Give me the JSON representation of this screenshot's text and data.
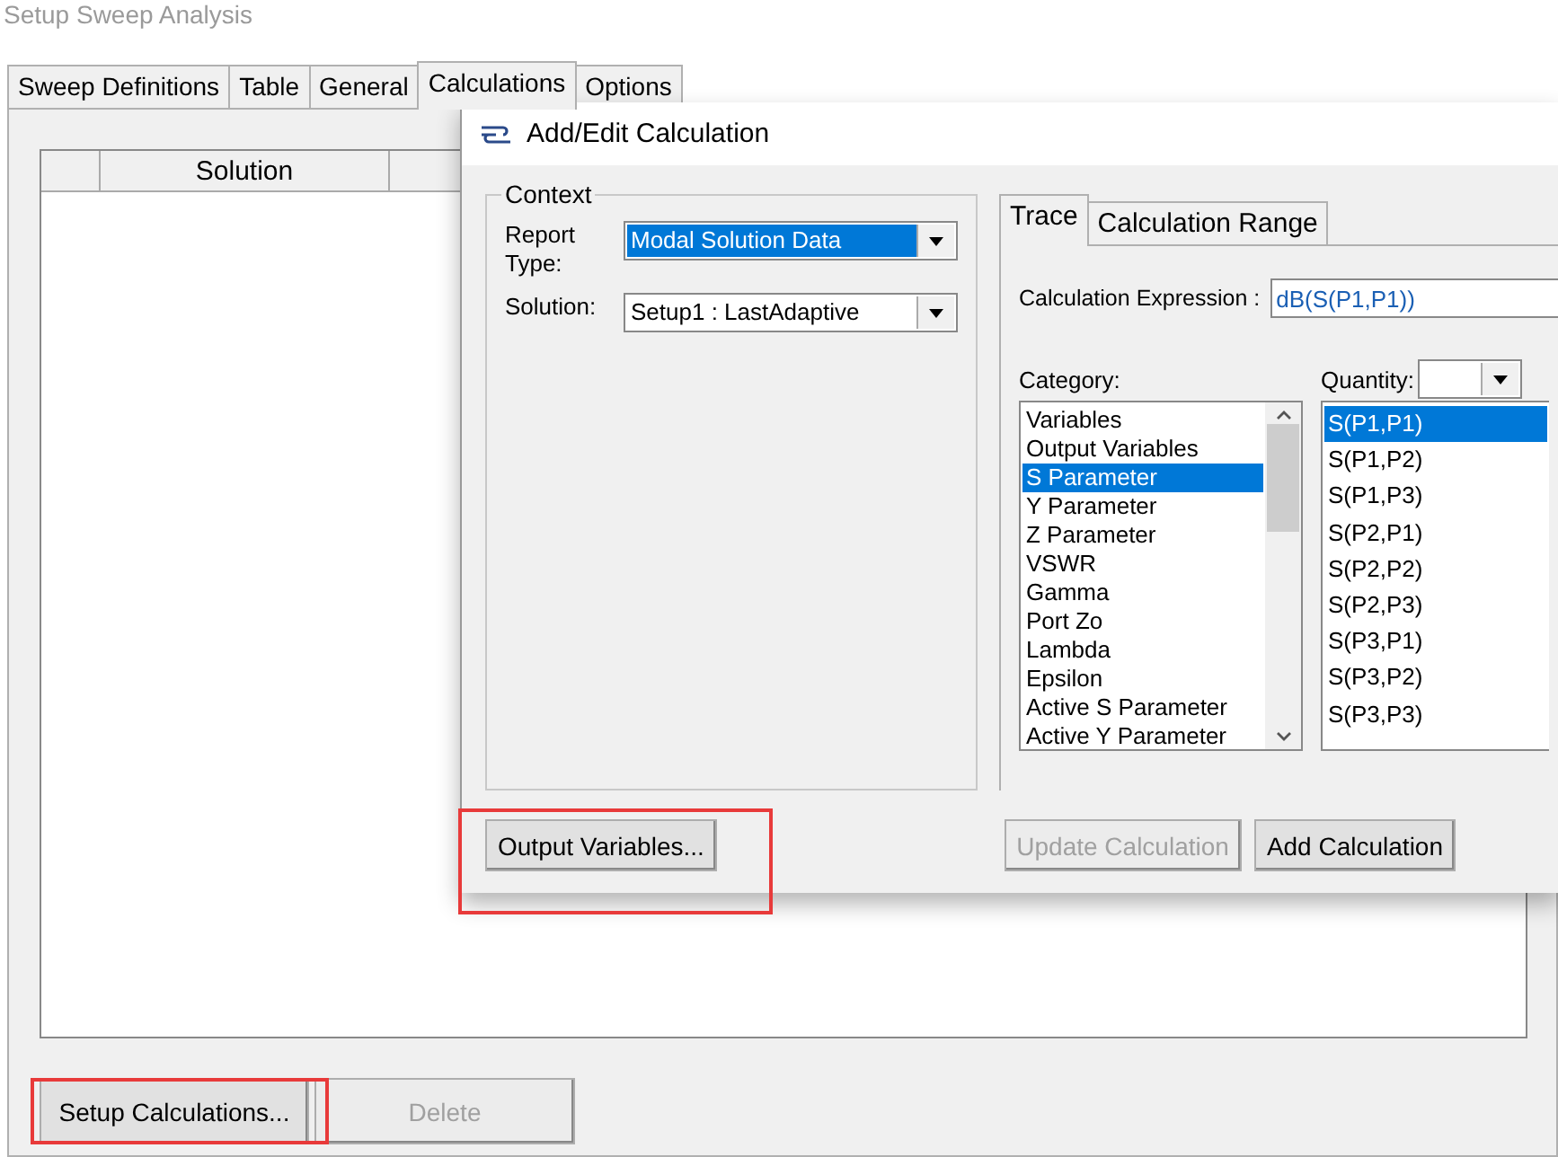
{
  "main_window": {
    "title": "Setup Sweep Analysis",
    "tabs": [
      {
        "label": "Sweep Definitions",
        "selected": false
      },
      {
        "label": "Table",
        "selected": false
      },
      {
        "label": "General",
        "selected": false
      },
      {
        "label": "Calculations",
        "selected": true
      },
      {
        "label": "Options",
        "selected": false
      }
    ],
    "table": {
      "columns": [
        {
          "label": "Solution"
        }
      ]
    },
    "buttons": [
      {
        "label": "Setup Calculations...",
        "disabled": false
      },
      {
        "label": "Delete",
        "disabled": true
      }
    ]
  },
  "dialog": {
    "title": "Add/Edit Calculation",
    "context": {
      "title": "Context",
      "fields": [
        {
          "label": "Report Type:",
          "value": "Modal Solution Data",
          "highlighted": true
        },
        {
          "label": "Solution:",
          "value": "Setup1 : LastAdaptive",
          "highlighted": false
        }
      ]
    },
    "tabs": [
      {
        "label": "Trace",
        "selected": true
      },
      {
        "label": "Calculation Range",
        "selected": false
      }
    ],
    "expression": {
      "label": "Calculation Expression :",
      "value": "dB(S(P1,P1))"
    },
    "category": {
      "label": "Category:",
      "items": [
        {
          "label": "Variables",
          "selected": false
        },
        {
          "label": "Output Variables",
          "selected": false
        },
        {
          "label": "S Parameter",
          "selected": true
        },
        {
          "label": "Y Parameter",
          "selected": false
        },
        {
          "label": "Z Parameter",
          "selected": false
        },
        {
          "label": "VSWR",
          "selected": false
        },
        {
          "label": "Gamma",
          "selected": false
        },
        {
          "label": "Port Zo",
          "selected": false
        },
        {
          "label": "Lambda",
          "selected": false
        },
        {
          "label": "Epsilon",
          "selected": false
        },
        {
          "label": "Active S Parameter",
          "selected": false
        },
        {
          "label": "Active Y Parameter",
          "selected": false
        }
      ]
    },
    "quantity": {
      "label": "Quantity:",
      "items": [
        {
          "label": "S(P1,P1)",
          "selected": true
        },
        {
          "label": "S(P1,P2)",
          "selected": false
        },
        {
          "label": "S(P1,P3)",
          "selected": false
        },
        {
          "label": "S(P2,P1)",
          "selected": false
        },
        {
          "label": "S(P2,P2)",
          "selected": false
        },
        {
          "label": "S(P2,P3)",
          "selected": false
        },
        {
          "label": "S(P3,P1)",
          "selected": false
        },
        {
          "label": "S(P3,P2)",
          "selected": false
        },
        {
          "label": "S(P3,P3)",
          "selected": false
        }
      ]
    },
    "left_buttons": [
      {
        "label": "Output Variables...",
        "disabled": false
      }
    ],
    "right_buttons": [
      {
        "label": "Update Calculation",
        "disabled": true
      },
      {
        "label": "Add Calculation",
        "disabled": false
      }
    ]
  }
}
